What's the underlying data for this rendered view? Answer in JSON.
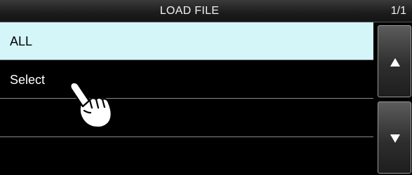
{
  "header": {
    "title": "LOAD FILE",
    "page": "1/1"
  },
  "list": {
    "items": [
      {
        "label": "ALL",
        "selected": true
      },
      {
        "label": "Select",
        "selected": false
      },
      {
        "label": "",
        "selected": false
      },
      {
        "label": "",
        "selected": false
      }
    ]
  },
  "scroll": {
    "up_icon": "triangle-up-icon",
    "down_icon": "triangle-down-icon"
  },
  "overlay": {
    "pointer_icon": "hand-pointer-icon"
  },
  "colors": {
    "background": "#000000",
    "selected_row": "#d4f6f9",
    "text": "#ffffff",
    "divider": "#8a8a8a"
  }
}
